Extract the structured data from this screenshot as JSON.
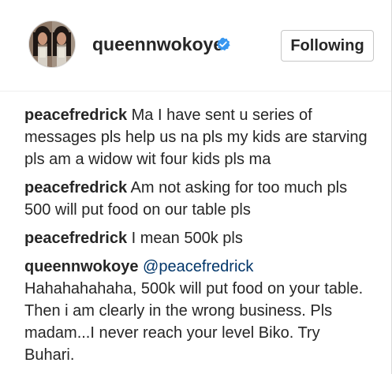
{
  "profile": {
    "username": "queennwokoye",
    "verified": true,
    "follow_label": "Following"
  },
  "comments": [
    {
      "author": "peacefredrick",
      "text": "Ma I have sent u series of messages pls help us na pls my kids are starving pls am a widow wit four kids pls ma"
    },
    {
      "author": "peacefredrick",
      "text": "Am not asking for too much pls 500 will put food on our table pls"
    },
    {
      "author": "peacefredrick",
      "text": "I mean 500k pls"
    },
    {
      "author": "queennwokoye",
      "mention": "@peacefredrick",
      "text": "Hahahahahaha, 500k will put food on your table. Then i am clearly in the wrong business. Pls madam...I never reach your level Biko. Try Buhari."
    }
  ],
  "colors": {
    "verified_badge": "#3897f0",
    "mention": "#003569",
    "text": "#262626"
  },
  "icons": {
    "verified": "verified-badge-icon"
  }
}
